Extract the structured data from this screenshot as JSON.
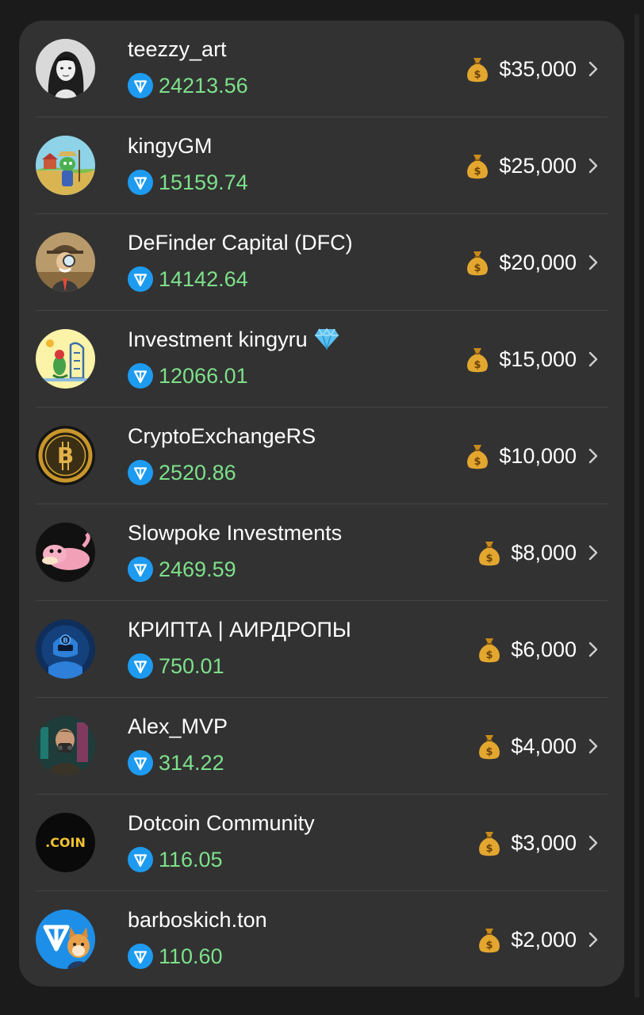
{
  "leaderboard": {
    "rows": [
      {
        "name": "teezzy_art",
        "balance": "24213.56",
        "prize": "$35,000",
        "avatar": "portrait-photo-avatar",
        "badge": ""
      },
      {
        "name": "kingyGM",
        "balance": "15159.74",
        "prize": "$25,000",
        "avatar": "cartoon-lizard-farmer-avatar",
        "badge": ""
      },
      {
        "name": "DeFinder Capital (DFC)",
        "balance": "14142.64",
        "prize": "$20,000",
        "avatar": "detective-with-magnifier-avatar",
        "badge": ""
      },
      {
        "name": "Investment kingyru",
        "balance": "12066.01",
        "prize": "$15,000",
        "avatar": "lizard-with-tower-avatar",
        "badge": "diamond-icon"
      },
      {
        "name": "CryptoExchangeRS",
        "balance": "2520.86",
        "prize": "$10,000",
        "avatar": "bitcoin-coin-avatar",
        "badge": ""
      },
      {
        "name": "Slowpoke Investments",
        "balance": "2469.59",
        "prize": "$8,000",
        "avatar": "slowpoke-avatar",
        "badge": ""
      },
      {
        "name": "КРИПТА | АИРДРОПЫ",
        "balance": "750.01",
        "prize": "$6,000",
        "avatar": "blue-gamer-bitcoin-avatar",
        "badge": ""
      },
      {
        "name": "Alex_MVP",
        "balance": "314.22",
        "prize": "$4,000",
        "avatar": "masked-man-avatar",
        "badge": ""
      },
      {
        "name": "Dotcoin Community",
        "balance": "116.05",
        "prize": "$3,000",
        "avatar": "dotcoin-logo-avatar",
        "badge": ""
      },
      {
        "name": "barboskich.ton",
        "balance": "110.60",
        "prize": "$2,000",
        "avatar": "ton-logo-dog-avatar",
        "badge": ""
      }
    ],
    "icons": {
      "balance_icon": "ton-icon",
      "prize_icon": "money-bag-icon",
      "row_action_icon": "chevron-right-icon"
    },
    "colors": {
      "background": "#1b1b1b",
      "card": "#323232",
      "balance_text": "#7de08a",
      "ton_blue": "#1d9bf0",
      "name_text": "#ffffff"
    }
  }
}
